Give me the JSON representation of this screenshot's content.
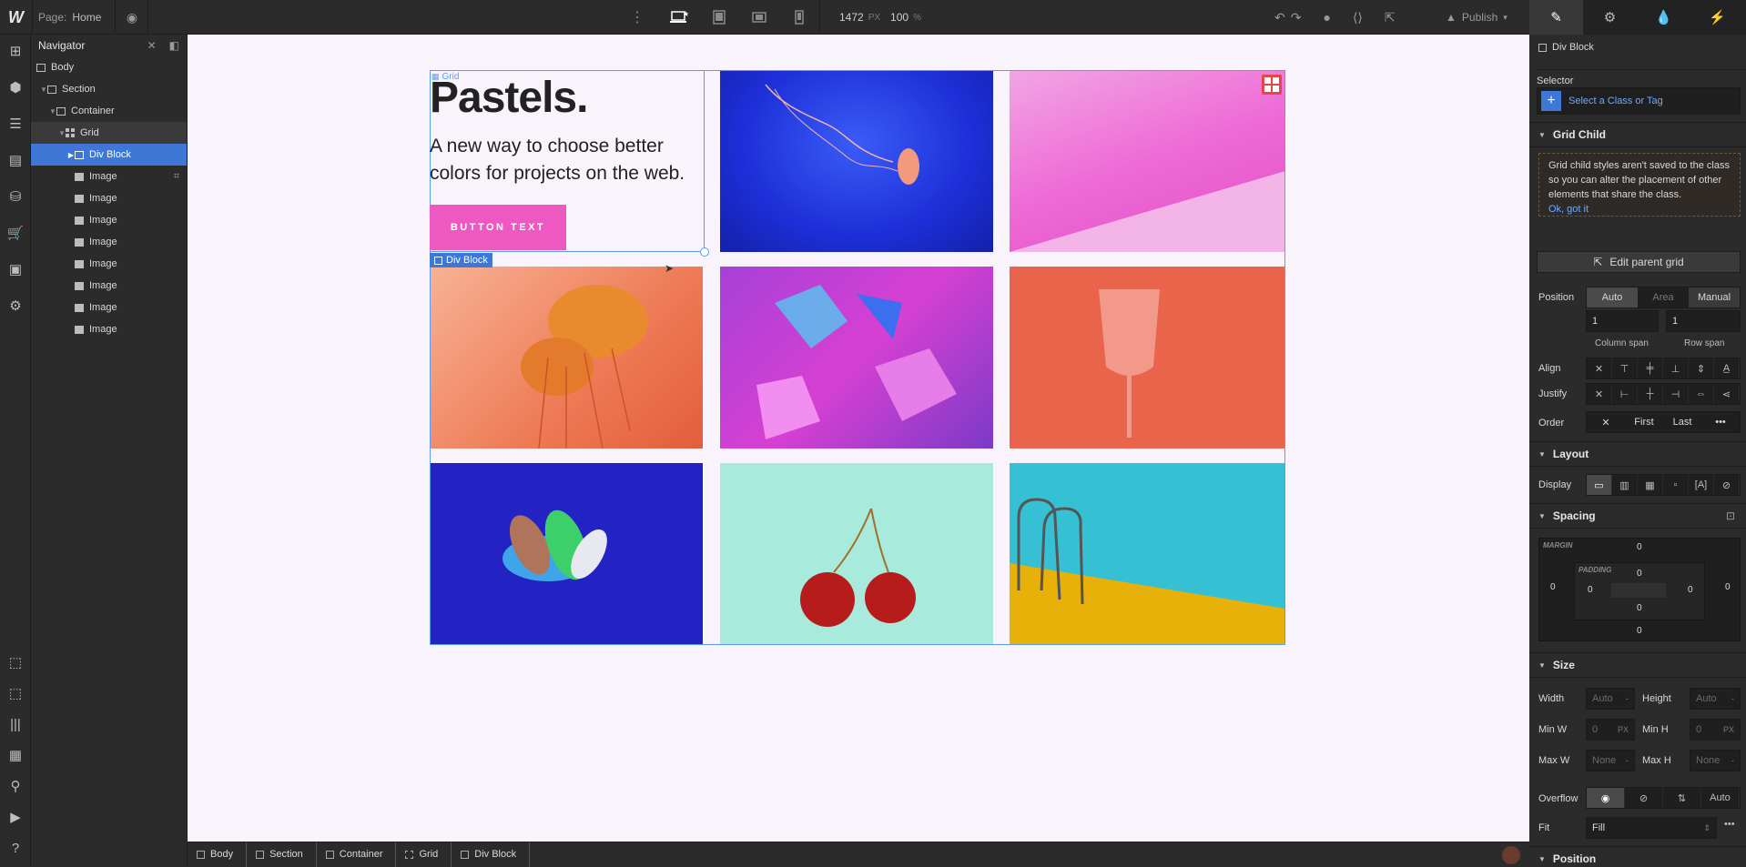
{
  "topbar": {
    "logo": "W",
    "page_label": "Page:",
    "page_name": "Home",
    "width": "1472",
    "width_unit": "PX",
    "zoom": "100",
    "zoom_unit": "%",
    "publish": "Publish"
  },
  "navigator": {
    "title": "Navigator",
    "items": [
      {
        "label": "Body"
      },
      {
        "label": "Section"
      },
      {
        "label": "Container"
      },
      {
        "label": "Grid"
      },
      {
        "label": "Div Block"
      },
      {
        "label": "Image"
      },
      {
        "label": "Image"
      },
      {
        "label": "Image"
      },
      {
        "label": "Image"
      },
      {
        "label": "Image"
      },
      {
        "label": "Image"
      },
      {
        "label": "Image"
      },
      {
        "label": "Image"
      }
    ]
  },
  "canvas": {
    "grid_label": "Grid",
    "heading": "Pastels.",
    "tagline": "A new way to choose better colors for projects on the web.",
    "button": "BUTTON TEXT",
    "div_label": "Div Block"
  },
  "breadcrumb": [
    "Body",
    "Section",
    "Container",
    "Grid",
    "Div Block"
  ],
  "panel": {
    "element": "Div Block",
    "selector_label": "Selector",
    "selector_placeholder": "Select a Class or Tag",
    "grid_child": {
      "title": "Grid Child",
      "notice": "Grid child styles aren't saved to the class so you can alter the placement of other elements that share the class.",
      "notice_link": "Ok, got it",
      "edit_parent": "Edit parent grid",
      "position_label": "Position",
      "position_options": [
        "Auto",
        "Area",
        "Manual"
      ],
      "column_span": "1",
      "row_span": "1",
      "column_span_label": "Column span",
      "row_span_label": "Row span",
      "align_label": "Align",
      "justify_label": "Justify",
      "order_label": "Order",
      "order_options": [
        "First",
        "Last"
      ]
    },
    "layout": {
      "title": "Layout",
      "display_label": "Display"
    },
    "spacing": {
      "title": "Spacing",
      "margin_label": "MARGIN",
      "padding_label": "PADDING",
      "margin": {
        "top": "0",
        "right": "0",
        "bottom": "0",
        "left": "0"
      },
      "padding": {
        "top": "0",
        "right": "0",
        "bottom": "0",
        "left": "0"
      }
    },
    "size": {
      "title": "Size",
      "width_label": "Width",
      "width": "Auto",
      "height_label": "Height",
      "height": "Auto",
      "minw_label": "Min W",
      "minw": "0",
      "minh_label": "Min H",
      "minh": "0",
      "maxw_label": "Max W",
      "maxw": "None",
      "maxh_label": "Max H",
      "maxh": "None",
      "overflow_label": "Overflow",
      "overflow_auto": "Auto",
      "fit_label": "Fit",
      "fit": "Fill",
      "unit_px": "PX",
      "unit_dash": "-"
    },
    "position_section": {
      "title": "Position"
    }
  }
}
